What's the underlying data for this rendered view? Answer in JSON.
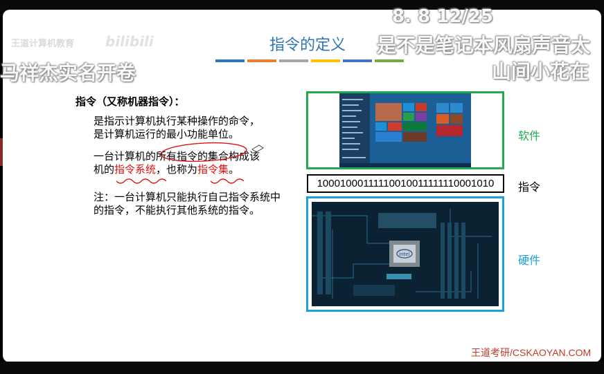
{
  "slide": {
    "title": "指令的定义",
    "accent_bars": [
      "#2e75b6",
      "#ed7d31",
      "#a5a5a5",
      "#ffc000",
      "#4472c4",
      "#70ad47"
    ],
    "heading": "指令（又称机器指令）：",
    "para1_line1": "是指示计算机执行某种操作的命令，",
    "para1_line2": "是计算机运行的最小功能单位。",
    "para2_a": "一台计算机的所有指令的集合构成该",
    "para2_b": "机的",
    "para2_red1": "指令系统",
    "para2_c": "，也称为",
    "para2_red2": "指令集",
    "para2_d": "。",
    "note": "注：一台计算机只能执行自己指令系统中的指令，不能执行其他系统的指令。",
    "binary_code": "10001000111110010011111110001010",
    "label_software": "软件",
    "label_instruction": "指令",
    "label_hardware": "硬件",
    "chip_text": "intel",
    "brand": "王道考研/CSKAOYAN.COM",
    "colors": {
      "software": "#22a94f",
      "hardware": "#19a2dc",
      "title": "#2e75b6",
      "red": "#e01010"
    }
  },
  "overlay": {
    "danmaku_time": "8. 8      12/25",
    "danmaku_1": "是不是笔记本风扇声音太",
    "danmaku_2": "马祥杰实名开卷",
    "danmaku_3": "山间小花在",
    "watermark_channel": "王道计算机教育",
    "watermark_site": "bilibili"
  }
}
